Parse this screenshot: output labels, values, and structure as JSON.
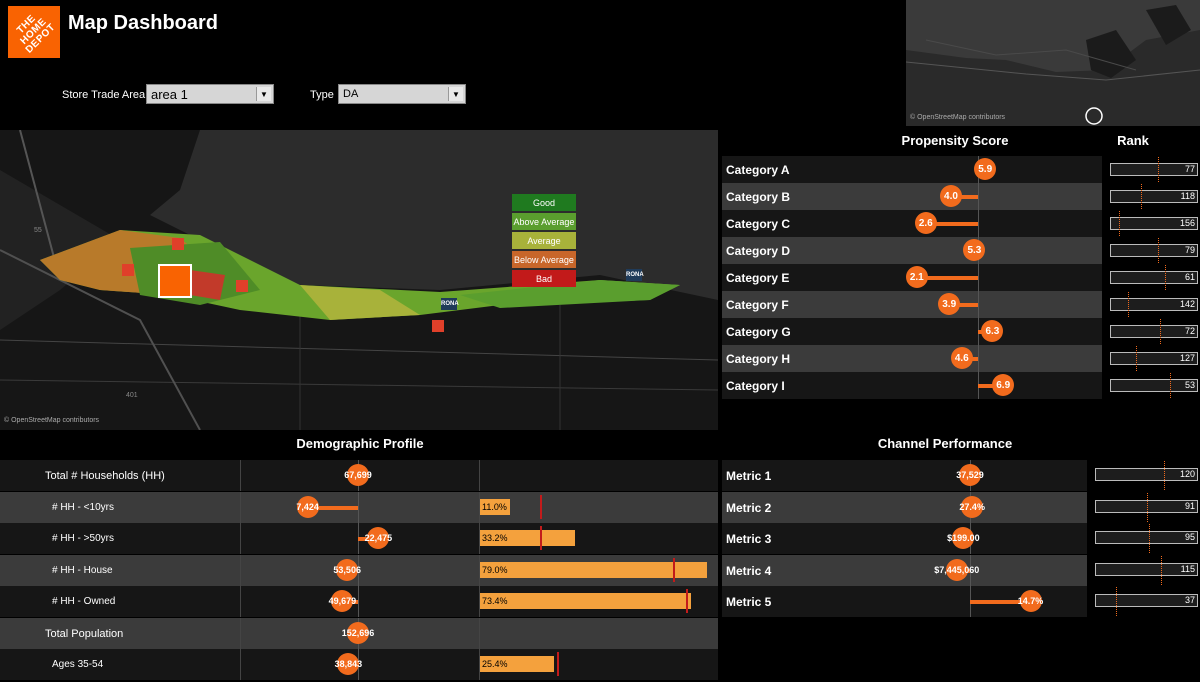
{
  "header": {
    "logo_text": "THE HOME DEPOT",
    "title": "Map Dashboard"
  },
  "filters": {
    "store_label": "Store Trade Area",
    "store_value": "area 1",
    "type_label": "Type",
    "type_value": "DA"
  },
  "map": {
    "attribution": "© OpenStreetMap contributors",
    "minimap_attribution": "© OpenStreetMap contributors",
    "legend": [
      {
        "label": "Good",
        "color": "#1f7a1f"
      },
      {
        "label": "Above Average",
        "color": "#5a9e2e"
      },
      {
        "label": "Average",
        "color": "#a8b23a"
      },
      {
        "label": "Below Average",
        "color": "#c8662a"
      },
      {
        "label": "Bad",
        "color": "#c21a1a"
      }
    ],
    "pins": [
      "RONA",
      "RONA"
    ],
    "road_labels": [
      "55",
      "401"
    ]
  },
  "propensity": {
    "title": "Propensity Score",
    "rank_title": "Rank",
    "rows": [
      {
        "name": "Category A",
        "score": "5.9",
        "value": 5.9,
        "rank": "77",
        "rank_frac": 0.55
      },
      {
        "name": "Category B",
        "score": "4.0",
        "value": 4.0,
        "rank": "118",
        "rank_frac": 0.35
      },
      {
        "name": "Category C",
        "score": "2.6",
        "value": 2.6,
        "rank": "156",
        "rank_frac": 0.1
      },
      {
        "name": "Category D",
        "score": "5.3",
        "value": 5.3,
        "rank": "79",
        "rank_frac": 0.55
      },
      {
        "name": "Category E",
        "score": "2.1",
        "value": 2.1,
        "rank": "61",
        "rank_frac": 0.63
      },
      {
        "name": "Category F",
        "score": "3.9",
        "value": 3.9,
        "rank": "142",
        "rank_frac": 0.2
      },
      {
        "name": "Category G",
        "score": "6.3",
        "value": 6.3,
        "rank": "72",
        "rank_frac": 0.57
      },
      {
        "name": "Category H",
        "score": "4.6",
        "value": 4.6,
        "rank": "127",
        "rank_frac": 0.3
      },
      {
        "name": "Category I",
        "score": "6.9",
        "value": 6.9,
        "rank": "53",
        "rank_frac": 0.68
      }
    ]
  },
  "demographic": {
    "title": "Demographic Profile",
    "rows": [
      {
        "name": "Total # Households (HH)",
        "indent": false,
        "count": "67,699",
        "count_frac": 0.0,
        "pct": "",
        "pct_frac": 0,
        "bench_frac": 0
      },
      {
        "name": "# HH - <10yrs",
        "indent": true,
        "count": "7,424",
        "count_frac": -0.42,
        "pct": "11.0%",
        "pct_frac": 0.13,
        "bench_frac": 0.26
      },
      {
        "name": "# HH - >50yrs",
        "indent": true,
        "count": "22,475",
        "count_frac": 0.17,
        "pct": "33.2%",
        "pct_frac": 0.41,
        "bench_frac": 0.26
      },
      {
        "name": "# HH - House",
        "indent": true,
        "count": "53,506",
        "count_frac": -0.09,
        "pct": "79.0%",
        "pct_frac": 0.98,
        "bench_frac": 0.83
      },
      {
        "name": "# HH - Owned",
        "indent": true,
        "count": "49,679",
        "count_frac": -0.13,
        "pct": "73.4%",
        "pct_frac": 0.91,
        "bench_frac": 0.89
      },
      {
        "name": "Total Population",
        "indent": false,
        "count": "152,696",
        "count_frac": 0.0,
        "pct": "",
        "pct_frac": 0,
        "bench_frac": 0
      },
      {
        "name": "Ages 35-54",
        "indent": true,
        "count": "38,843",
        "count_frac": -0.08,
        "pct": "25.4%",
        "pct_frac": 0.32,
        "bench_frac": 0.33
      }
    ]
  },
  "channel": {
    "title": "Channel Performance",
    "rows": [
      {
        "name": "Metric 1",
        "value": "37,529",
        "frac": 0.0,
        "rank": "120",
        "rank_frac": 0.67
      },
      {
        "name": "Metric 2",
        "value": "27.4%",
        "frac": 0.02,
        "rank": "91",
        "rank_frac": 0.5
      },
      {
        "name": "Metric 3",
        "value": "$199.00",
        "frac": -0.06,
        "rank": "95",
        "rank_frac": 0.52
      },
      {
        "name": "Metric 4",
        "value": "$7,445,060",
        "frac": -0.12,
        "rank": "115",
        "rank_frac": 0.64
      },
      {
        "name": "Metric 5",
        "value": "14.7%",
        "frac": 0.55,
        "rank": "37",
        "rank_frac": 0.2
      }
    ]
  }
}
